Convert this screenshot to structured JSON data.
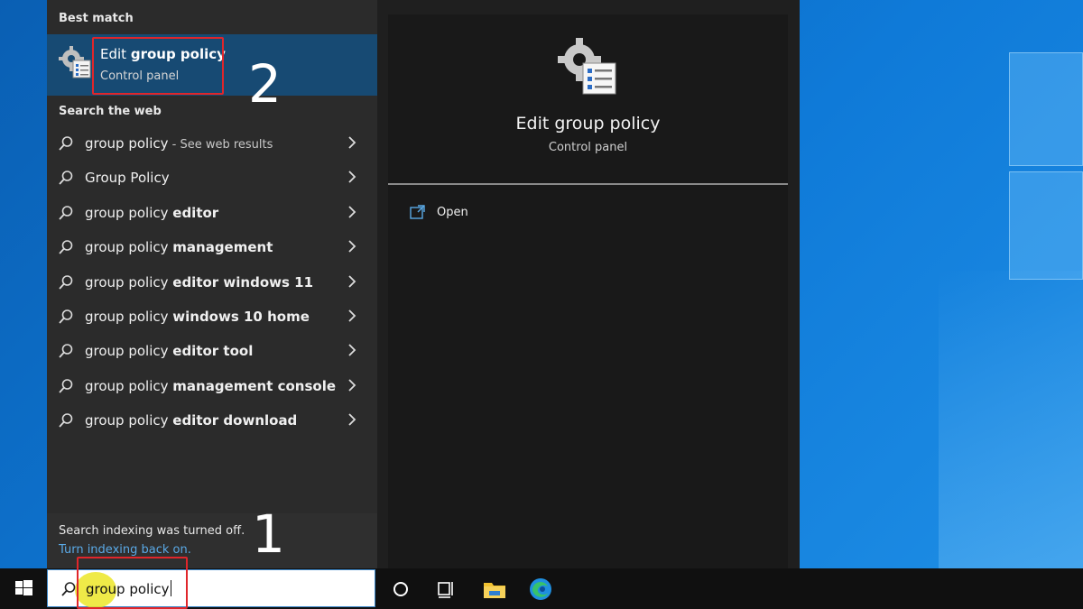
{
  "flyout": {
    "best_match_heading": "Best match",
    "best_match": {
      "title_prefix": "Edit ",
      "title_bold": "group policy",
      "subtitle": "Control panel"
    },
    "web_heading": "Search the web",
    "web_results": [
      {
        "prefix": "group policy",
        "bold": "",
        "suffix": " - See web results"
      },
      {
        "prefix": "Group Policy",
        "bold": "",
        "suffix": ""
      },
      {
        "prefix": "group policy ",
        "bold": "editor",
        "suffix": ""
      },
      {
        "prefix": "group policy ",
        "bold": "management",
        "suffix": ""
      },
      {
        "prefix": "group policy ",
        "bold": "editor windows 11",
        "suffix": ""
      },
      {
        "prefix": "group policy ",
        "bold": "windows 10 home",
        "suffix": ""
      },
      {
        "prefix": "group policy ",
        "bold": "editor tool",
        "suffix": ""
      },
      {
        "prefix": "group policy ",
        "bold": "management console",
        "suffix": ""
      },
      {
        "prefix": "group policy ",
        "bold": "editor download",
        "suffix": ""
      }
    ],
    "indexing": {
      "message": "Search indexing was turned off.",
      "link": "Turn indexing back on."
    },
    "detail": {
      "title": "Edit group policy",
      "subtitle": "Control panel",
      "actions": [
        {
          "label": "Open",
          "icon": "open-icon"
        }
      ]
    }
  },
  "annotations": {
    "step_1": "1",
    "step_2": "2"
  },
  "taskbar": {
    "search_value": "group policy",
    "icons": [
      "windows-start-icon",
      "cortana-icon",
      "task-view-icon",
      "file-explorer-icon",
      "edge-icon"
    ]
  },
  "colors": {
    "accent_selected": "#174a73",
    "annotation_red": "#e0262b",
    "link_blue": "#5aa9e6",
    "highlight_yellow": "#ece628"
  }
}
